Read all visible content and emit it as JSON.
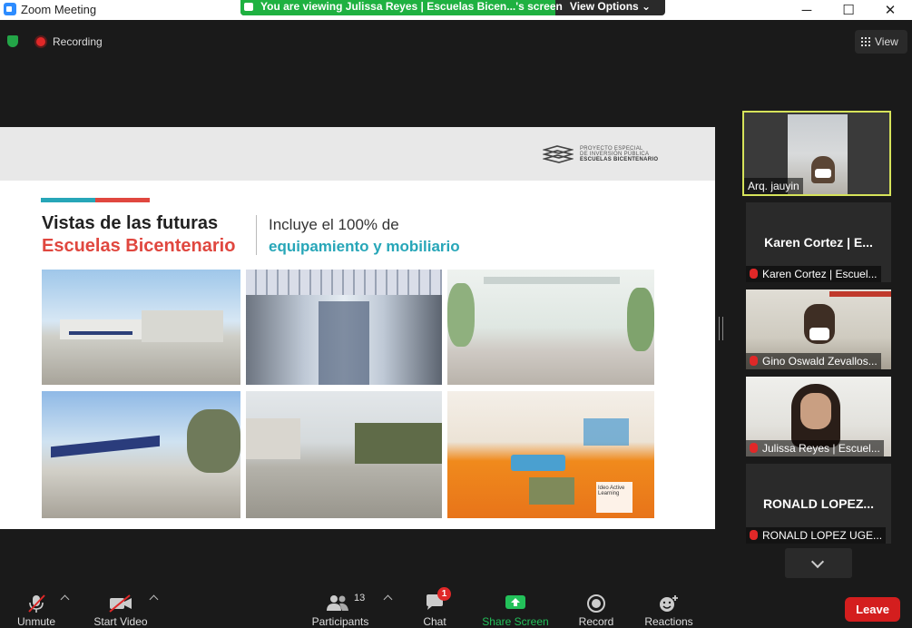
{
  "window": {
    "title": "Zoom Meeting",
    "minimize": "─",
    "maximize": "☐",
    "close": "✕"
  },
  "banner": {
    "text": "You are viewing Julissa Reyes | Escuelas Bicen...'s screen",
    "options_label": "View Options ⌄"
  },
  "status": {
    "recording_label": "Recording",
    "view_label": "View"
  },
  "slide": {
    "org_lines": [
      "PROYECTO ESPECIAL",
      "DE INVERSIÓN PÚBLICA",
      "ESCUELAS BICENTENARIO"
    ],
    "heading_line1": "Vistas de las futuras",
    "heading_line2": "Escuelas Bicentenario",
    "sub_line1": "Incluye el 100% de",
    "sub_line2": "equipamiento y mobiliario",
    "image_caption": "Ideo Active Learning"
  },
  "participants": [
    {
      "label": "Arq. jauyin",
      "video": true,
      "active": true
    },
    {
      "display_name": "Karen Cortez | E...",
      "label": "Karen Cortez | Escuel...",
      "video": false
    },
    {
      "label": "Gino Oswald Zevallos...",
      "video": true
    },
    {
      "label": "Julissa Reyes | Escuel...",
      "video": true
    },
    {
      "display_name": "RONALD LOPEZ...",
      "label": "RONALD LOPEZ UGE...",
      "video": false
    }
  ],
  "toolbar": {
    "unmute": "Unmute",
    "start_video": "Start Video",
    "participants": "Participants",
    "participants_count": "13",
    "chat": "Chat",
    "chat_badge": "1",
    "share_screen": "Share Screen",
    "record": "Record",
    "reactions": "Reactions",
    "leave": "Leave"
  },
  "colors": {
    "banner_green": "#1fb141",
    "active_border": "#d6e35a",
    "leave_red": "#d41e1e",
    "share_green": "#23c15a"
  }
}
